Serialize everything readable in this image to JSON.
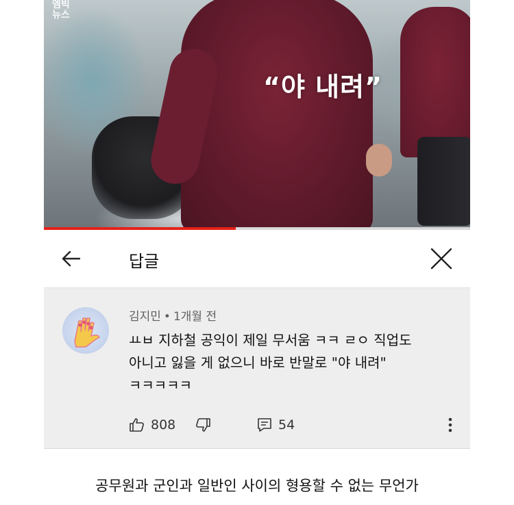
{
  "video": {
    "watermark_line1": "엠빅",
    "watermark_line2": "뉴스",
    "overlay_quote": "“야 내려”",
    "progress": 0.45,
    "progress_color": "#e62117"
  },
  "header": {
    "back_icon": "arrow-left-icon",
    "title": "답글",
    "close_icon": "close-icon"
  },
  "comment": {
    "author": "김지민",
    "separator": "•",
    "time": "1개월 전",
    "text_line1": "ㅛㅂ 지하철 공익이 제일 무서움 ㅋㅋ ㄹㅇ 직업도",
    "text_line2": "아니고 잃을 게 없으니 바로 반말로 \"야 내려\"",
    "text_line3": "ㅋㅋㅋㅋㅋ",
    "likes": "808",
    "replies": "54",
    "like_icon": "thumbs-up-icon",
    "dislike_icon": "thumbs-down-icon",
    "reply_icon": "reply-icon",
    "more_icon": "more-vertical-icon"
  },
  "caption": "공무원과 군인과 일반인 사이의 형용할 수 없는 무언가"
}
